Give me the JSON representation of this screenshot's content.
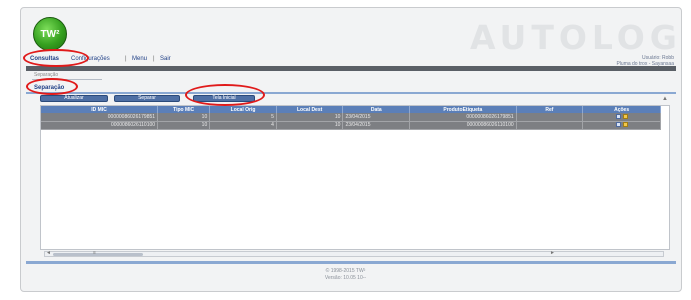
{
  "app": {
    "logo_text": "TW²",
    "brand": "AUTOLOG"
  },
  "menu": {
    "items": [
      "Consultas",
      "Configurações",
      "Menu",
      "Sair"
    ],
    "separator": "|"
  },
  "user": {
    "line1": "Usuário: Robb",
    "line2": "Pluma do trox - Sayansaa"
  },
  "subtab": {
    "label": "Separação"
  },
  "section": {
    "title": "Separação"
  },
  "toolbar": {
    "buttons": [
      "Atualizar",
      "Separar",
      "Tela Inicial"
    ]
  },
  "table": {
    "columns": [
      "ID MIC",
      "Tipo MIC",
      "Local Orig",
      "Local Dest",
      "Data",
      "ProdutoEtiqueta",
      "Ref",
      "Ações"
    ],
    "rows": [
      [
        "00000086026179851",
        "10",
        "5",
        "10",
        "23/04/2015",
        "00000086026179851",
        "",
        ""
      ],
      [
        "0000086026110100",
        "10",
        "4",
        "10",
        "23/04/2015",
        "00000086026110100",
        "",
        ""
      ]
    ],
    "action_icons": [
      "document-icon",
      "edit-icon"
    ]
  },
  "scrollbar": {
    "left_arrow": "◄",
    "thumb_grip": "≡",
    "right_arrow": "►",
    "up_arrow": "▲"
  },
  "footer": {
    "copyright": "© 1998-2015 TW²",
    "version": "Versão: 10.05 10--"
  },
  "annotations": {
    "color": "#e01a1a"
  }
}
